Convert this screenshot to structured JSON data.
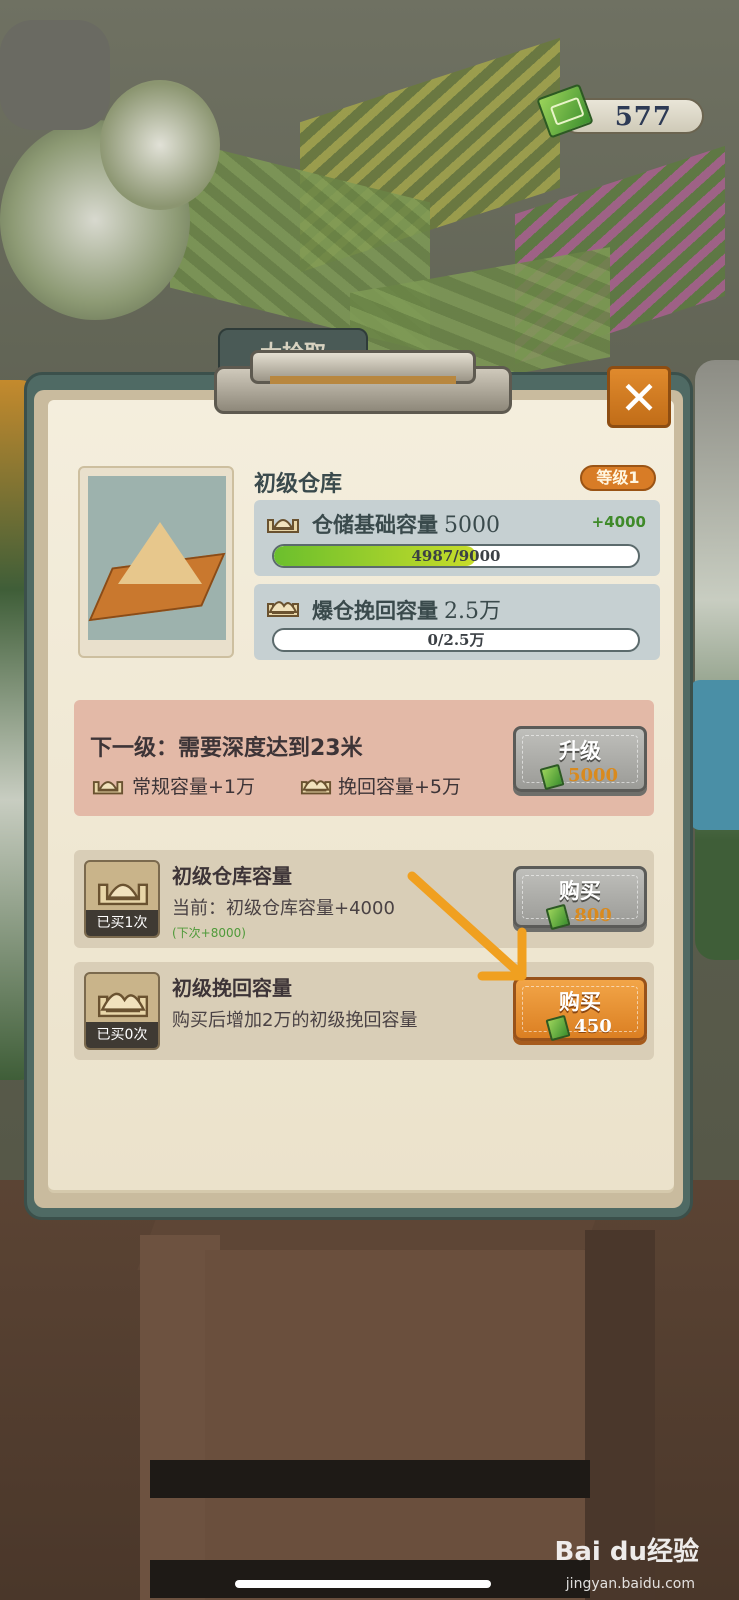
{
  "currency": {
    "value": "577"
  },
  "tab_behind": {
    "label": "大拾取"
  },
  "close": {
    "label": "✕"
  },
  "item": {
    "name": "初级仓库",
    "level": "等级1",
    "stats": [
      {
        "label": "仓储基础容量",
        "value": "5000",
        "bonus": "+4000",
        "bar_text": "4987/9000",
        "progress": 0.554
      },
      {
        "label": "爆仓挽回容量",
        "value": "2.5万",
        "bonus": "",
        "bar_text": "0/2.5万",
        "progress": 0.0
      }
    ]
  },
  "next_level": {
    "title": "下一级：需要深度达到23米",
    "benefit_1": "常规容量+1万",
    "benefit_2": "挽回容量+5万",
    "upgrade_label": "升级",
    "upgrade_price": "5000"
  },
  "shop": [
    {
      "name": "初级仓库容量",
      "desc": "当前：初级仓库容量+4000",
      "next": "(下次+8000)",
      "bought": "已买1次",
      "button_label": "购买",
      "price": "800"
    },
    {
      "name": "初级挽回容量",
      "desc": "购买后增加2万的初级挽回容量",
      "next": "",
      "bought": "已买0次",
      "button_label": "购买",
      "price": "450"
    }
  ],
  "watermark": {
    "brand": "Bai du经验",
    "url": "jingyan.baidu.com"
  },
  "colors": {
    "accent_orange": "#db7f22",
    "panel_teal": "#4f6a64",
    "progress_green": "#6bbf2d"
  }
}
